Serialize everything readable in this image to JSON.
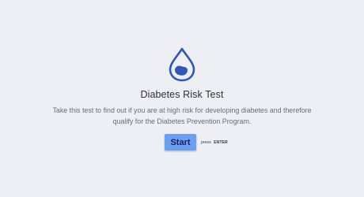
{
  "icon": "water-drop-icon",
  "colors": {
    "background": "#eeeef5",
    "accent": "#2f59b5",
    "button": "#6b9ff0",
    "button_text": "#18206a"
  },
  "intro": {
    "title": "Diabetes Risk Test",
    "description": "Take this test to find out if you are at high risk for developing diabetes and therefore qualify for the Diabetes Prevention Program.",
    "start_label": "Start",
    "hint_prefix": "press",
    "hint_key": "ENTER"
  }
}
